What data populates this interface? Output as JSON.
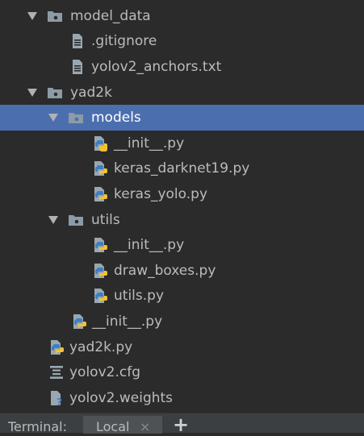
{
  "tree": {
    "items": [
      {
        "label": "model_data",
        "type": "folder",
        "expanded": true,
        "depth": 0,
        "icon": "folder-icon"
      },
      {
        "label": ".gitignore",
        "type": "text-file",
        "depth": 1,
        "icon": "text-file-icon"
      },
      {
        "label": "yolov2_anchors.txt",
        "type": "text-file",
        "depth": 1,
        "icon": "text-file-icon"
      },
      {
        "label": "yad2k",
        "type": "folder",
        "expanded": true,
        "depth": 0,
        "icon": "folder-icon"
      },
      {
        "label": "models",
        "type": "folder",
        "expanded": true,
        "depth": 1,
        "selected": true,
        "icon": "folder-icon"
      },
      {
        "label": "__init__.py",
        "type": "python-file",
        "depth": 2,
        "icon": "python-file-icon"
      },
      {
        "label": "keras_darknet19.py",
        "type": "python-file",
        "depth": 2,
        "icon": "python-file-icon"
      },
      {
        "label": "keras_yolo.py",
        "type": "python-file",
        "depth": 2,
        "icon": "python-file-icon"
      },
      {
        "label": "utils",
        "type": "folder",
        "expanded": true,
        "depth": 1,
        "icon": "folder-icon"
      },
      {
        "label": "__init__.py",
        "type": "python-file",
        "depth": 2,
        "icon": "python-file-icon"
      },
      {
        "label": "draw_boxes.py",
        "type": "python-file",
        "depth": 2,
        "icon": "python-file-icon"
      },
      {
        "label": "utils.py",
        "type": "python-file",
        "depth": 2,
        "icon": "python-file-icon"
      },
      {
        "label": "__init__.py",
        "type": "python-file",
        "depth": 1,
        "icon": "python-file-icon"
      },
      {
        "label": "yad2k.py",
        "type": "python-file",
        "depth": 0,
        "icon": "python-file-icon"
      },
      {
        "label": "yolov2.cfg",
        "type": "config-file",
        "depth": 0,
        "icon": "config-file-icon"
      },
      {
        "label": "yolov2.weights",
        "type": "unknown-file",
        "depth": 0,
        "icon": "unknown-file-icon"
      }
    ]
  },
  "terminal": {
    "title": "Terminal:",
    "tab_label": "Local",
    "close_glyph": "×",
    "add_glyph": "+"
  },
  "colors": {
    "background": "#2b2b2b",
    "selection": "#4b6eaf",
    "text": "#bbbbbb",
    "folder": "#8c9ba5",
    "python_blue": "#3e7fc1",
    "python_yellow": "#f2c230"
  }
}
